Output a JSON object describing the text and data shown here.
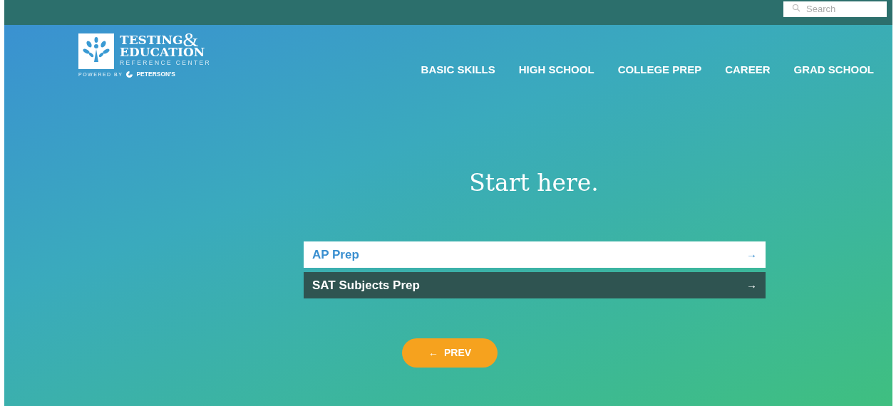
{
  "top_bar": {
    "search": {
      "placeholder": "Search"
    }
  },
  "logo": {
    "line_1": "TESTING",
    "ampersand": "&",
    "line_2": "EDUCATION",
    "line_3": "REFERENCE CENTER",
    "powered_by": "POWERED BY",
    "brand": "PETERSON'S"
  },
  "nav": [
    "BASIC SKILLS",
    "HIGH SCHOOL",
    "COLLEGE PREP",
    "CAREER",
    "GRAD SCHOOL"
  ],
  "heading": "Start here.",
  "options": [
    {
      "label": "AP Prep",
      "arrow": "→",
      "selected": true
    },
    {
      "label": "SAT Subjects Prep",
      "arrow": "→",
      "selected": false
    }
  ],
  "prev_button": {
    "arrow": "←",
    "label": "PREV"
  }
}
